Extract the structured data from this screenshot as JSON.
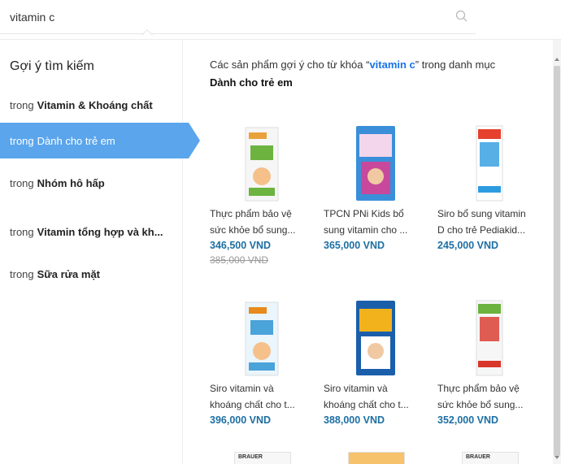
{
  "search": {
    "value": "vitamin c"
  },
  "sidebar": {
    "title": "Gợi ý tìm kiếm",
    "items": [
      {
        "prefix": "trong",
        "category": "Vitamin & Khoáng chất",
        "active": false
      },
      {
        "prefix": "trong",
        "category": "Dành cho trẻ em",
        "active": true
      },
      {
        "prefix": "trong",
        "category": "Nhóm hô hấp",
        "active": false
      },
      {
        "prefix": "trong",
        "category": "Vitamin tổng hợp và kh...",
        "active": false
      },
      {
        "prefix": "trong",
        "category": "Sữa rửa mặt",
        "active": false
      }
    ]
  },
  "results": {
    "heading_prefix": "Các sản phẩm gợi ý cho từ khóa “",
    "keyword": "vitamin c",
    "heading_mid": "” trong danh mục",
    "category": "Dành cho trẻ em"
  },
  "products": [
    {
      "line1": "Thực phẩm bảo vệ",
      "line2": "sức khỏe bổ sung...",
      "price": "346,500 VND",
      "old_price": "385,000 VND",
      "image": "brauer-vitamin-c-box",
      "colors": [
        "#f6f6f6",
        "#e9a23a",
        "#6cb33f"
      ]
    },
    {
      "line1": "TPCN PNi Kids bổ",
      "line2": "sung vitamin cho ...",
      "price": "365,000 VND",
      "old_price": "",
      "image": "pni-kids-multivitamin-box",
      "colors": [
        "#c8489b",
        "#3b8fd9",
        "#f4d6ec"
      ]
    },
    {
      "line1": "Siro bổ sung vitamin",
      "line2": "D cho trẻ Pediakid...",
      "price": "245,000 VND",
      "old_price": "",
      "image": "pediakid-vitamin-d-box",
      "colors": [
        "#ffffff",
        "#2d9be0",
        "#e5412d"
      ]
    },
    {
      "line1": "Siro vitamin và",
      "line2": "khoáng chất cho t...",
      "price": "396,000 VND",
      "old_price": "",
      "image": "wellbaby-syrup-box",
      "colors": [
        "#eaf5fc",
        "#e88a1c",
        "#4aa3d9"
      ]
    },
    {
      "line1": "Siro vitamin và",
      "line2": "khoáng chất cho t...",
      "price": "388,000 VND",
      "old_price": "",
      "image": "wellkid-multivitamin-box",
      "colors": [
        "#ffffff",
        "#1b5fab",
        "#f2b21c"
      ]
    },
    {
      "line1": "Thực phẩm bảo vệ",
      "line2": "sức khỏe bổ sung...",
      "price": "352,000 VND",
      "old_price": "",
      "image": "brauer-vitamin-c-0-box",
      "colors": [
        "#f6f6f6",
        "#d9362b",
        "#6cb33f"
      ]
    }
  ],
  "peek_products": [
    {
      "image": "brauer-box-peek",
      "label": "BRAUER"
    },
    {
      "image": "orange-box-peek",
      "label": ""
    },
    {
      "image": "brauer-box-peek",
      "label": "BRAUER"
    }
  ]
}
